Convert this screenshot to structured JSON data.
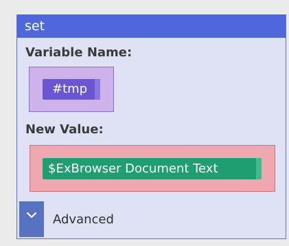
{
  "block": {
    "title": "set",
    "variable_label": "Variable Name:",
    "variable_value": "#tmp",
    "value_label": "New Value:",
    "value_value": "$ExBrowser Document Text",
    "advanced_label": "Advanced"
  },
  "icons": {
    "advanced_toggle": "chevron-down-icon"
  },
  "colors": {
    "header": "#4f67dc",
    "block_bg": "#dfe2f5",
    "variable_box": "#cdb2ec",
    "variable_chip": "#6a55d3",
    "value_box": "#f0a8b0",
    "value_chip": "#1f9e72",
    "toggle": "#5672c0"
  }
}
